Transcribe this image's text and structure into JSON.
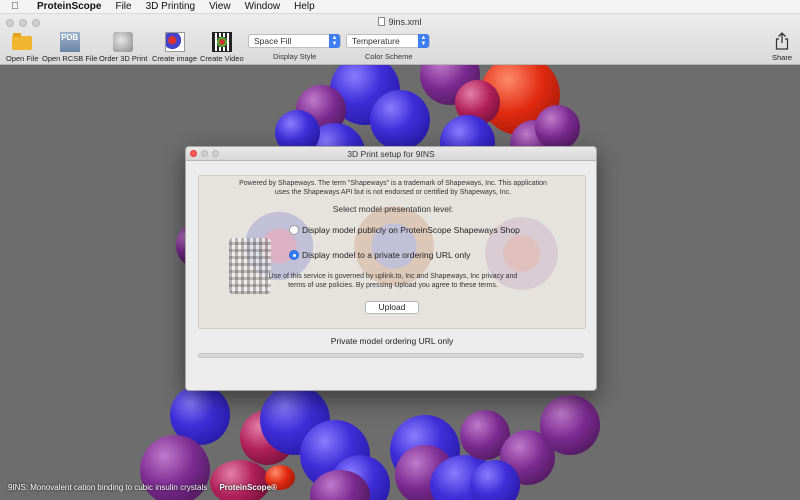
{
  "menubar": {
    "app": "ProteinScope",
    "items": [
      "File",
      "3D Printing",
      "View",
      "Window",
      "Help"
    ]
  },
  "window": {
    "title": "9ins.xml"
  },
  "toolbar": {
    "open_file": "Open File",
    "open_rcsb": "Open RCSB File",
    "pdb_icon_text": "PDB",
    "order_3d": "Order 3D Print",
    "create_image": "Create image",
    "create_video": "Create Video",
    "display_style_value": "Space Fill",
    "display_style_label": "Display Style",
    "color_scheme_value": "Temperature",
    "color_scheme_label": "Color Scheme",
    "share": "Share"
  },
  "caption": {
    "text": "9INS: Monovalent cation binding to cubic insulin crystals",
    "brand": "ProteinScope®"
  },
  "dialog": {
    "title": "3D Print setup for 9INS",
    "lead": "Powered by Shapeways. The term \"Shapeways\" is a trademark of Shapeways, Inc.  This application uses the Shapeways API but is not endorsed or certified by Shapeways, Inc.",
    "select_label": "Select model presentation level:",
    "options": [
      {
        "label": "Display model publicly on ProteinScope Shapeways Shop",
        "selected": false
      },
      {
        "label": "Display model to a private ordering URL only",
        "selected": true
      }
    ],
    "terms": "Use of this service is governed by uplink.to, Inc and Shapeways, Inc privacy and terms of use policies. By pressing Upload you agree to these terms.",
    "upload": "Upload",
    "status": "Private model ordering URL only",
    "progress": 0
  },
  "colors": {
    "accent": "#3d7ff3",
    "close": "#fc5753"
  }
}
